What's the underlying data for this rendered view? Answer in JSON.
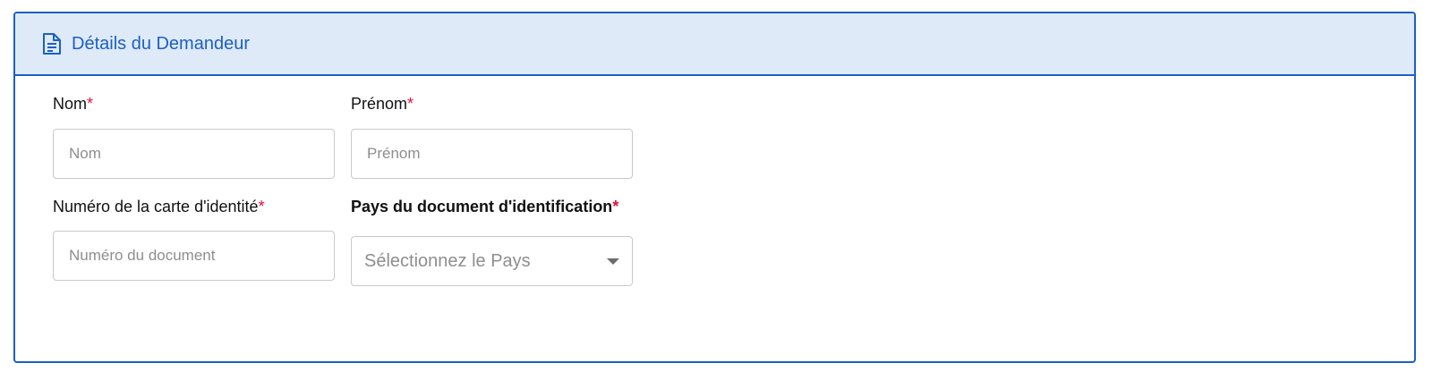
{
  "panel": {
    "title": "Détails du Demandeur",
    "icon": "document-icon",
    "accent_color": "#1a5fc7",
    "header_bg": "#dfeaf8"
  },
  "fields": {
    "nom": {
      "label": "Nom",
      "required_mark": "*",
      "placeholder": "Nom",
      "value": ""
    },
    "prenom": {
      "label": "Prénom",
      "required_mark": "*",
      "placeholder": "Prénom",
      "value": ""
    },
    "id_number": {
      "label": "Numéro de la carte d'identité",
      "required_mark": "*",
      "placeholder": "Numéro du document",
      "value": ""
    },
    "country": {
      "label": "Pays du document d'identification",
      "required_mark": "*",
      "selected": "Sélectionnez le Pays",
      "icon": "chevron-down-icon"
    }
  }
}
